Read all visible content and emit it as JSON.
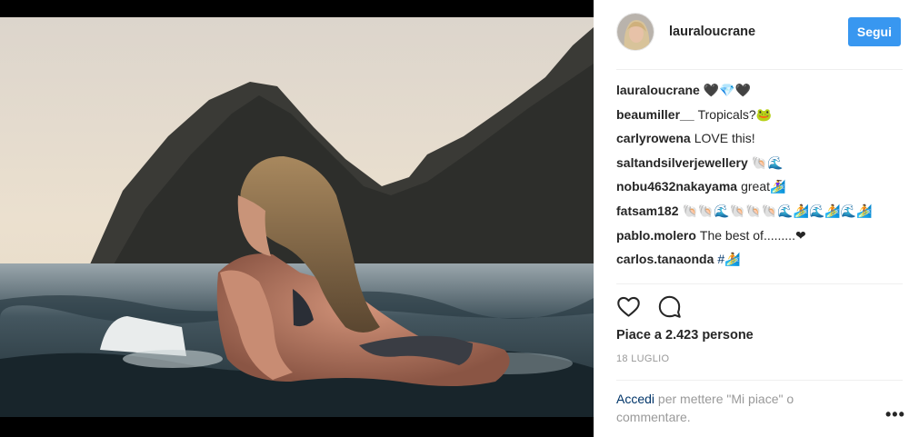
{
  "post": {
    "username": "lauraloucrane",
    "follow_label": "Segui",
    "likes_text": "Piace a 2.423 persone",
    "date": "18 LUGLIO",
    "login_link": "Accedi",
    "login_rest": " per mettere \"Mi piace\" o commentare.",
    "more_label": "•••"
  },
  "comments": [
    {
      "user": "lauraloucrane",
      "text": "🖤💎🖤",
      "link": ""
    },
    {
      "user": "beaumiller__",
      "text": "Tropicals?🐸",
      "link": ""
    },
    {
      "user": "carlyrowena",
      "text": "LOVE this!",
      "link": ""
    },
    {
      "user": "saltandsilverjewellery",
      "text": "🐚🌊",
      "link": ""
    },
    {
      "user": "nobu4632nakayama",
      "text": "great🏄‍♀️",
      "link": ""
    },
    {
      "user": "fatsam182",
      "text": "🐚🐚🌊🐚🐚🐚🌊🏄🌊🏄🌊🏄",
      "link": ""
    },
    {
      "user": "pablo.molero",
      "text": "The best of.........❤",
      "link": ""
    },
    {
      "user": "carlos.tanaonda",
      "text": "",
      "link": "#🏄"
    },
    {
      "user": "",
      "text": "",
      "link": ""
    }
  ],
  "icons": {
    "like": "heart-icon",
    "comment": "speech-bubble-icon",
    "more": "more-options-icon"
  },
  "colors": {
    "accent": "#3897f0",
    "link": "#003569",
    "muted": "#999999"
  }
}
